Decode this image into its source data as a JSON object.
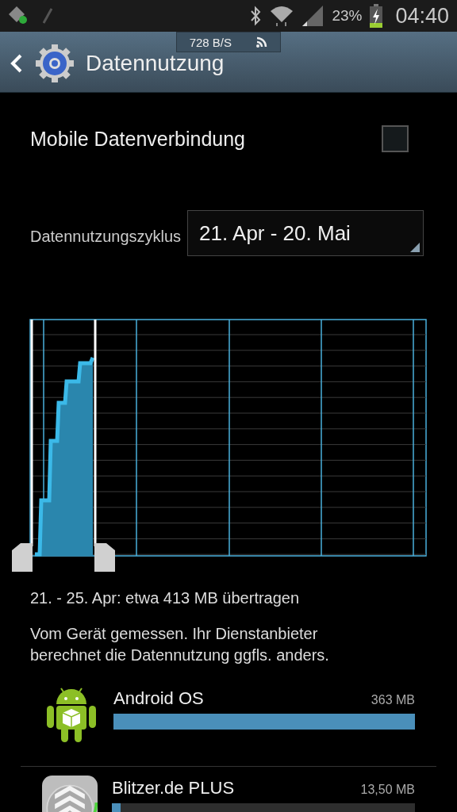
{
  "status_bar": {
    "battery_percent": "23%",
    "time": "04:40"
  },
  "network_speed": {
    "text": "728 B/S"
  },
  "action_bar": {
    "title": "Datennutzung"
  },
  "mobile_data": {
    "label": "Mobile Datenverbindung",
    "checked": false
  },
  "cycle": {
    "label": "Datennutzungszyklus",
    "value": "21. Apr - 20. Mai"
  },
  "summary": "21. - 25. Apr: etwa 413 MB übertragen",
  "note": "Vom Gerät gemessen. Ihr Dienstanbieter berechnet die Datennutzung ggfls. anders.",
  "apps": [
    {
      "kind": "android",
      "name": "Android OS",
      "amount": "363 MB",
      "level": 1
    },
    {
      "kind": "blitzer",
      "name": "Blitzer.de PLUS",
      "amount": "13,50 MB",
      "level": 0.03
    }
  ]
}
